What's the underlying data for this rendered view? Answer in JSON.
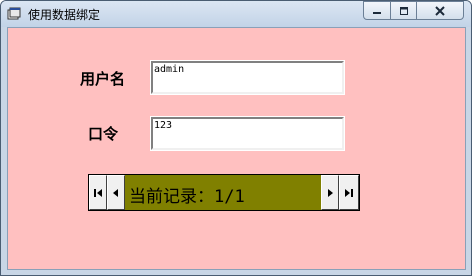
{
  "window": {
    "title": "使用数据绑定"
  },
  "form": {
    "username_label": "用户名",
    "username_value": "admin",
    "password_label": "口令",
    "password_value": "123"
  },
  "data_control": {
    "caption": "当前记录：1/1",
    "background_color": "#808000"
  },
  "icons": {
    "app": "app-icon",
    "minimize": "minimize-icon",
    "maximize": "maximize-icon",
    "close": "close-icon",
    "first": "first-record-icon",
    "prev": "previous-record-icon",
    "next": "next-record-icon",
    "last": "last-record-icon"
  }
}
